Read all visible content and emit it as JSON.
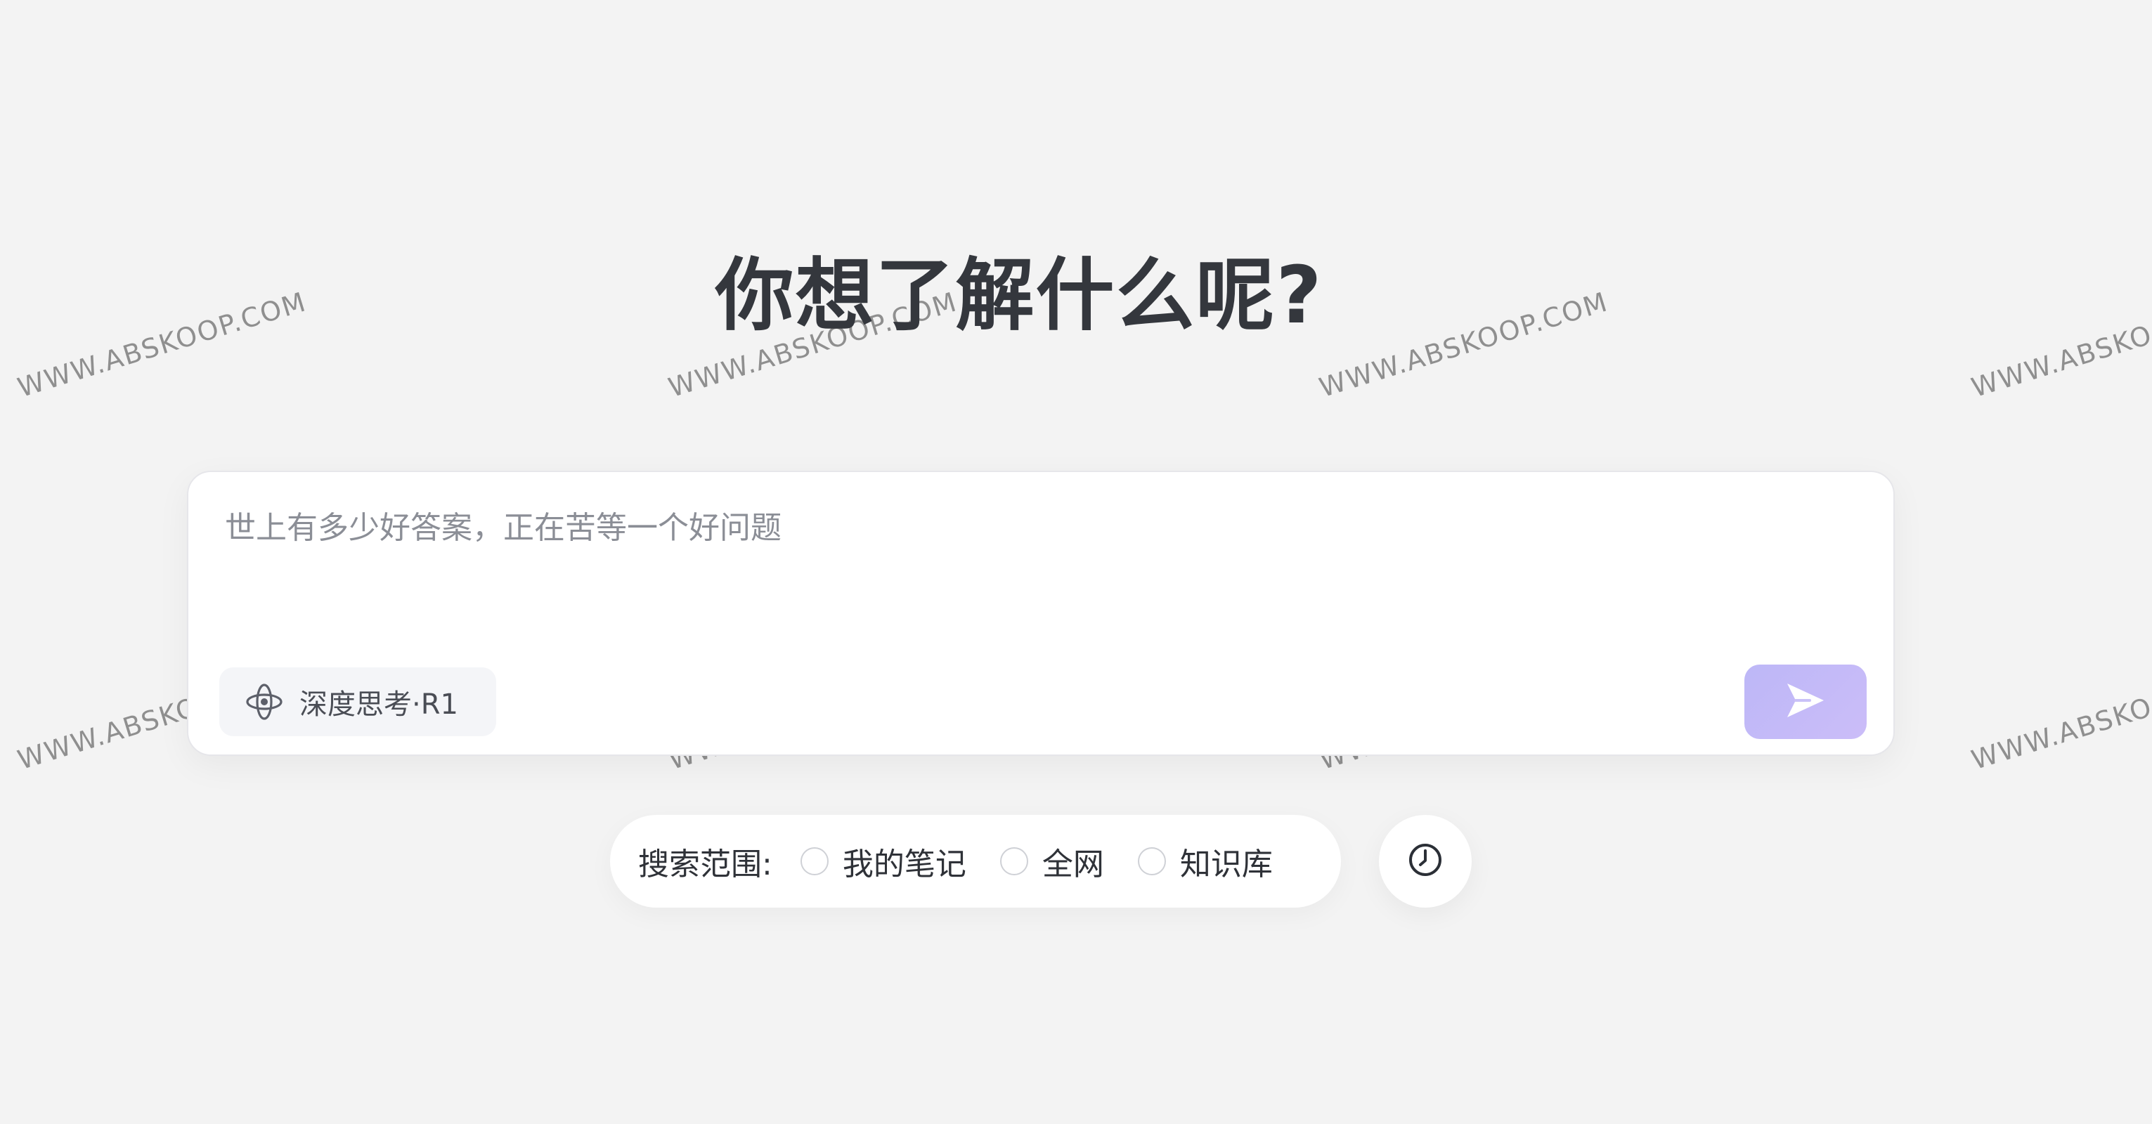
{
  "hero": {
    "title": "你想了解什么呢?"
  },
  "chat": {
    "placeholder": "世上有多少好答案，正在苦等一个好问题",
    "deep_think_label": "深度思考·R1",
    "deep_think_icon": "atom-orbit-icon",
    "send_icon": "send-arrow-icon",
    "send_color": "#c3baf8"
  },
  "scope": {
    "label": "搜索范围:",
    "options": [
      {
        "label": "我的笔记"
      },
      {
        "label": "全网"
      },
      {
        "label": "知识库"
      }
    ]
  },
  "history": {
    "icon": "clock-icon"
  },
  "watermark": {
    "text": "WWW.ABSKOOP.COM"
  }
}
